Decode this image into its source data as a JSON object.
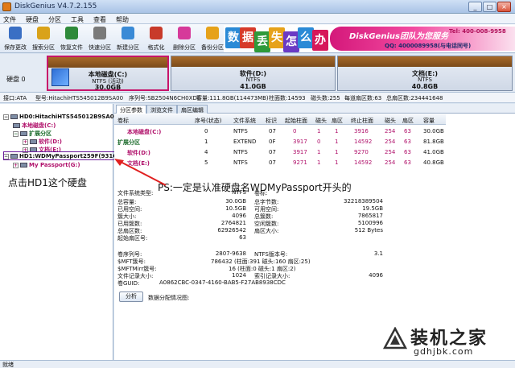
{
  "window": {
    "title": "DiskGenius V4.7.2.155",
    "min": "_",
    "max": "□",
    "close": "×"
  },
  "menu": [
    "文件",
    "硬盘",
    "分区",
    "工具",
    "查看",
    "帮助"
  ],
  "toolbar": [
    {
      "label": "保存更改",
      "color": "#3a6fc4"
    },
    {
      "label": "搜索分区",
      "color": "#d9a21a"
    },
    {
      "label": "恢复文件",
      "color": "#2e8a3a"
    },
    {
      "label": "快速分区",
      "color": "#7a7a7a"
    },
    {
      "label": "新建分区",
      "color": "#3a8ad6"
    },
    {
      "label": "格式化",
      "color": "#c83a2a"
    },
    {
      "label": "删除分区",
      "color": "#d63a9a"
    },
    {
      "label": "备份分区",
      "color": "#e6a21a"
    }
  ],
  "banner": {
    "tiles": [
      {
        "char": "数",
        "color": "#2a8ad6"
      },
      {
        "char": "据",
        "color": "#d63a2a"
      },
      {
        "char": "丢",
        "color": "#2e9a3a"
      },
      {
        "char": "失",
        "color": "#e6a21a"
      },
      {
        "char": "怎",
        "color": "#6a3ac4"
      },
      {
        "char": "么",
        "color": "#2a8ad6"
      },
      {
        "char": "办",
        "color": "#d6185a"
      }
    ],
    "brand": "DiskGenius团队为您服务",
    "tel": "Tel: 400-008-9958",
    "qq": "QQ: 4000089958(与电话同号)"
  },
  "diskmap": {
    "label": "硬盘 0",
    "partitions": [
      {
        "name": "本地磁盘(C:)",
        "fs": "NTFS (活动)",
        "size": "30.0GB",
        "selected": true
      },
      {
        "name": "软件(D:)",
        "fs": "NTFS",
        "size": "41.0GB",
        "selected": false
      },
      {
        "name": "文档(E:)",
        "fs": "NTFS",
        "size": "40.8GB",
        "selected": false
      }
    ]
  },
  "infobar": {
    "iface": "接口:ATA",
    "model": "型号:HitachiHTS545012B9SA00",
    "serial": "序列号:SB2504N6CH0XDE",
    "capacity": "容量:111.8GB(114473MB)",
    "cylinders": "柱面数:14593",
    "heads": "磁头数:255",
    "sectors": "每道扇区数:63",
    "total": "总扇区数:234441648"
  },
  "tree": {
    "hd0": "HD0:HitachiHTS545012B9SA0",
    "c": "本地磁盘(C:)",
    "ext": "扩展分区",
    "d": "软件(D:)",
    "e": "文档(E:)",
    "hd1": "HD1:WDMyPassport259F(931G",
    "passport": "My Passport(G:)"
  },
  "annotations": {
    "hd1": "点击HD1这个硬盘",
    "ps": "PS:一定是认准硬盘名WDMyPassport开头的"
  },
  "tabs": [
    "分区参数",
    "浏览文件",
    "扇区编辑"
  ],
  "ptable": {
    "headers": [
      "卷标",
      "序号(状态)",
      "文件系统",
      "标识",
      "起始柱面",
      "磁头",
      "扇区",
      "终止柱面",
      "磁头",
      "扇区",
      "容量"
    ],
    "rows": [
      {
        "name": "本地磁盘(C:)",
        "idx": "0",
        "fs": "NTFS",
        "id": "07",
        "sc": "0",
        "sh": "1",
        "ss": "1",
        "ec": "3916",
        "eh": "254",
        "es": "63",
        "cap": "30.0GB",
        "kind": "part"
      },
      {
        "name": "扩展分区",
        "idx": "1",
        "fs": "EXTEND",
        "id": "0F",
        "sc": "3917",
        "sh": "0",
        "ss": "1",
        "ec": "14592",
        "eh": "254",
        "es": "63",
        "cap": "81.8GB",
        "kind": "ext"
      },
      {
        "name": "软件(D:)",
        "idx": "4",
        "fs": "NTFS",
        "id": "07",
        "sc": "3917",
        "sh": "1",
        "ss": "1",
        "ec": "9270",
        "eh": "254",
        "es": "63",
        "cap": "41.0GB",
        "kind": "part"
      },
      {
        "name": "文档(E:)",
        "idx": "5",
        "fs": "NTFS",
        "id": "07",
        "sc": "9271",
        "sh": "1",
        "ss": "1",
        "ec": "14592",
        "eh": "254",
        "es": "63",
        "cap": "40.8GB",
        "kind": "part"
      }
    ]
  },
  "details": {
    "fs_type_label": "文件系统类型:",
    "fs_type": "NTFS",
    "vol_label": "卷标:",
    "vol": "",
    "left": [
      [
        "总容量:",
        "30.0GB"
      ],
      [
        "已用空间:",
        "10.5GB"
      ],
      [
        "簇大小:",
        "4096"
      ],
      [
        "已用簇数:",
        "2764821"
      ],
      [
        "总扇区数:",
        "62926542"
      ],
      [
        "起始扇区号:",
        "63"
      ]
    ],
    "right": [
      [
        "总字节数:",
        "32218389504"
      ],
      [
        "可用空间:",
        "19.5GB"
      ],
      [
        "总簇数:",
        "7865817"
      ],
      [
        "空闲簇数:",
        "5100996"
      ],
      [
        "扇区大小:",
        "512 Bytes"
      ]
    ],
    "serial_label": "卷序列号:",
    "serial": "2807-9638",
    "ntfs_ver_label": "NTFS版本号:",
    "ntfs_ver": "3.1",
    "mft_label": "$MFT簇号:",
    "mft": "786432 (柱面:391 磁头:160 扇区:25)",
    "mftmirr_label": "$MFTMirr簇号:",
    "mftmirr": "16 (柱面:0 磁头:1 扇区:2)",
    "rec_label": "文件记录大小:",
    "rec": "1024",
    "idx_label": "索引记录大小:",
    "idx": "4096",
    "guid_label": "卷GUID:",
    "guid": "A0862CBC-0347-4160-BAB5-F27AB8938CDC",
    "analyze": "分析",
    "map_label": "数据分配情况图:"
  },
  "status": "就绪",
  "watermark": {
    "title": "装机之家",
    "url": "gdhjbk.com"
  }
}
